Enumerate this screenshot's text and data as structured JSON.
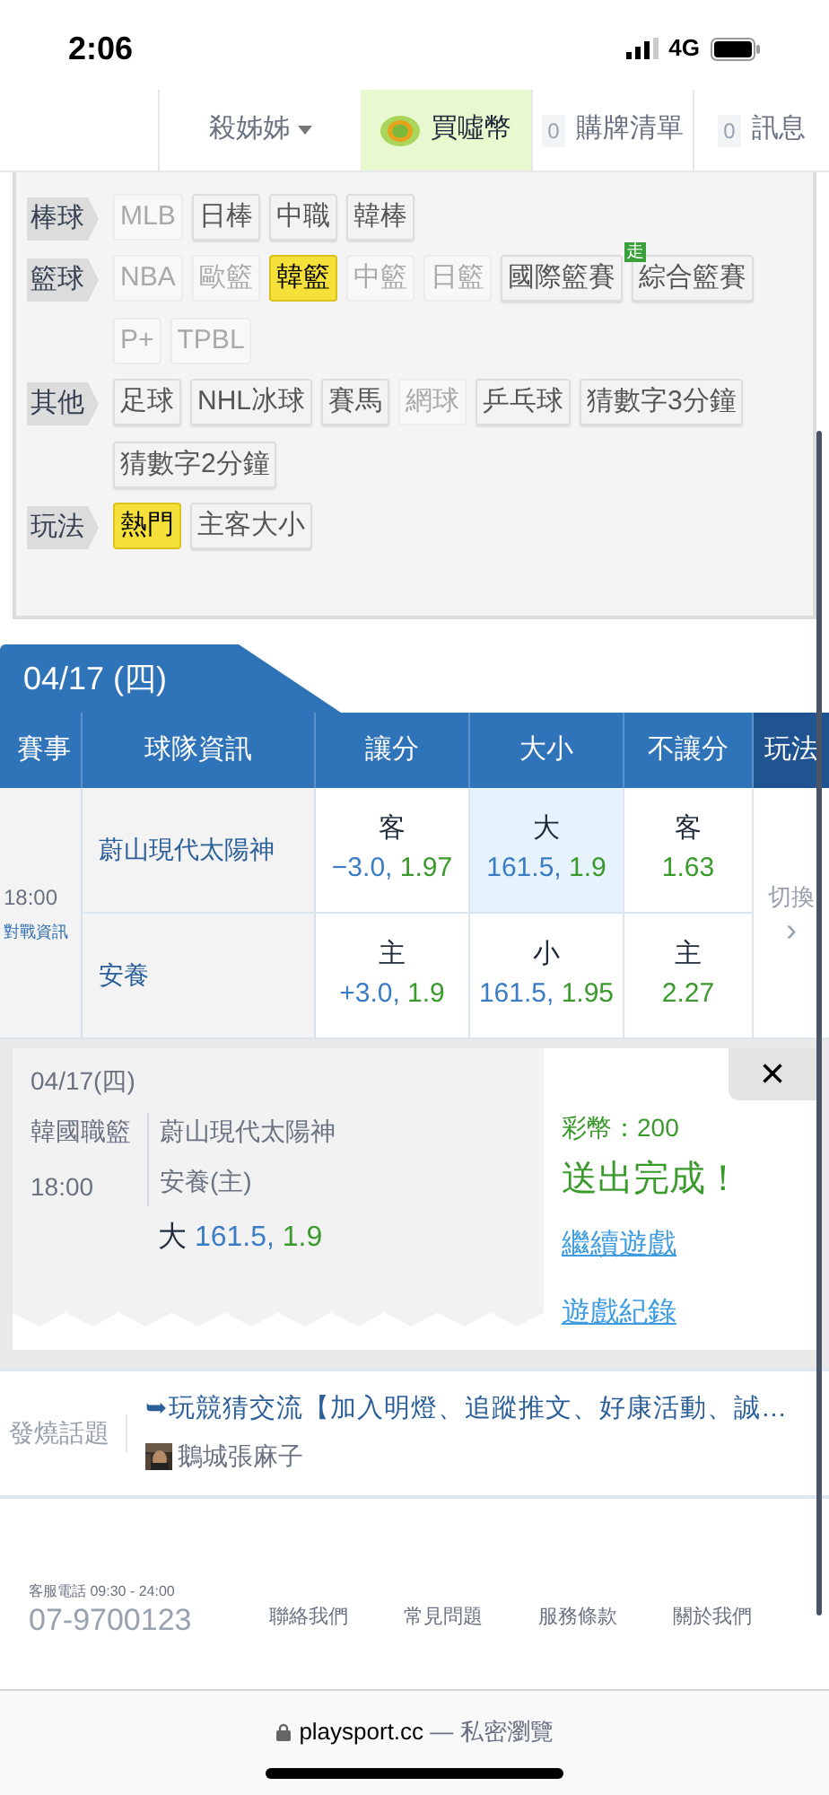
{
  "status_bar": {
    "time": "2:06",
    "network": "4G"
  },
  "nav": {
    "user": "殺姊姊",
    "buy": "買噓幣",
    "cart": {
      "count": "0",
      "label": "購牌清單"
    },
    "messages": {
      "count": "0",
      "label": "訊息"
    }
  },
  "filters": [
    {
      "category": "棒球",
      "tags": [
        {
          "label": "MLB",
          "selected": false,
          "disabled": true
        },
        {
          "label": "日棒",
          "selected": false,
          "disabled": false
        },
        {
          "label": "中職",
          "selected": false,
          "disabled": false
        },
        {
          "label": "韓棒",
          "selected": false,
          "disabled": false
        }
      ]
    },
    {
      "category": "籃球",
      "tags": [
        {
          "label": "NBA",
          "selected": false,
          "disabled": true
        },
        {
          "label": "歐籃",
          "selected": false,
          "disabled": true
        },
        {
          "label": "韓籃",
          "selected": true,
          "disabled": false
        },
        {
          "label": "中籃",
          "selected": false,
          "disabled": true
        },
        {
          "label": "日籃",
          "selected": false,
          "disabled": true
        },
        {
          "label": "國際籃賽",
          "selected": false,
          "disabled": false
        },
        {
          "label": "綜合籃賽",
          "selected": false,
          "disabled": false,
          "badge": "走"
        },
        {
          "label": "P+",
          "selected": false,
          "disabled": true
        },
        {
          "label": "TPBL",
          "selected": false,
          "disabled": true
        }
      ]
    },
    {
      "category": "其他",
      "tags": [
        {
          "label": "足球",
          "selected": false,
          "disabled": false
        },
        {
          "label": "NHL冰球",
          "selected": false,
          "disabled": false
        },
        {
          "label": "賽馬",
          "selected": false,
          "disabled": false
        },
        {
          "label": "網球",
          "selected": false,
          "disabled": true
        },
        {
          "label": "乒乓球",
          "selected": false,
          "disabled": false
        },
        {
          "label": "猜數字3分鐘",
          "selected": false,
          "disabled": false
        },
        {
          "label": "猜數字2分鐘",
          "selected": false,
          "disabled": false
        }
      ]
    },
    {
      "category": "玩法",
      "tags": [
        {
          "label": "熱門",
          "selected": true,
          "disabled": false
        },
        {
          "label": "主客大小",
          "selected": false,
          "disabled": false
        }
      ]
    }
  ],
  "date_tab": "04/17 (四)",
  "table": {
    "columns": [
      "賽事",
      "球隊資訊",
      "讓分",
      "大小",
      "不讓分",
      "玩法"
    ],
    "game": {
      "time": "18:00",
      "info_link": "對戰資訊",
      "switch": "切換",
      "switch_arrow": "›",
      "rows": [
        {
          "team": "蔚山現代太陽神",
          "cells": [
            {
              "side": "客",
              "line": "−3.0,",
              "odds": "1.97",
              "selected": false
            },
            {
              "side": "大",
              "line": "161.5,",
              "odds": "1.9",
              "selected": true
            },
            {
              "side": "客",
              "odds": "1.63",
              "selected": false
            }
          ]
        },
        {
          "team": "安養",
          "cells": [
            {
              "side": "主",
              "line": "+3.0,",
              "odds": "1.9",
              "selected": false
            },
            {
              "side": "小",
              "line": "161.5,",
              "odds": "1.95",
              "selected": false
            },
            {
              "side": "主",
              "odds": "2.27",
              "selected": false
            }
          ]
        }
      ]
    }
  },
  "confirmation": {
    "date": "04/17(四)",
    "league": "韓國職籃",
    "time": "18:00",
    "away": "蔚山現代太陽神",
    "home": "安養(主)",
    "pick": {
      "side": "大",
      "line": "161.5,",
      "odds": "1.9"
    },
    "cost": "彩幣：200",
    "message": "送出完成！",
    "links": [
      "繼續遊戲",
      "遊戲紀錄"
    ],
    "close": "×"
  },
  "hot_topic": {
    "label": "發燒話題",
    "title": "➥玩競猜交流【加入明燈、追蹤推文、好康活動、誠…",
    "author": "鵝城張麻子"
  },
  "footer": {
    "phone_label": "客服電話 09:30 - 24:00",
    "phone": "07-9700123",
    "links": [
      "聯絡我們",
      "常見問題",
      "服務條款",
      "關於我們"
    ]
  },
  "browser_bar": {
    "domain": "playsport.cc",
    "mode": "— 私密瀏覽"
  }
}
